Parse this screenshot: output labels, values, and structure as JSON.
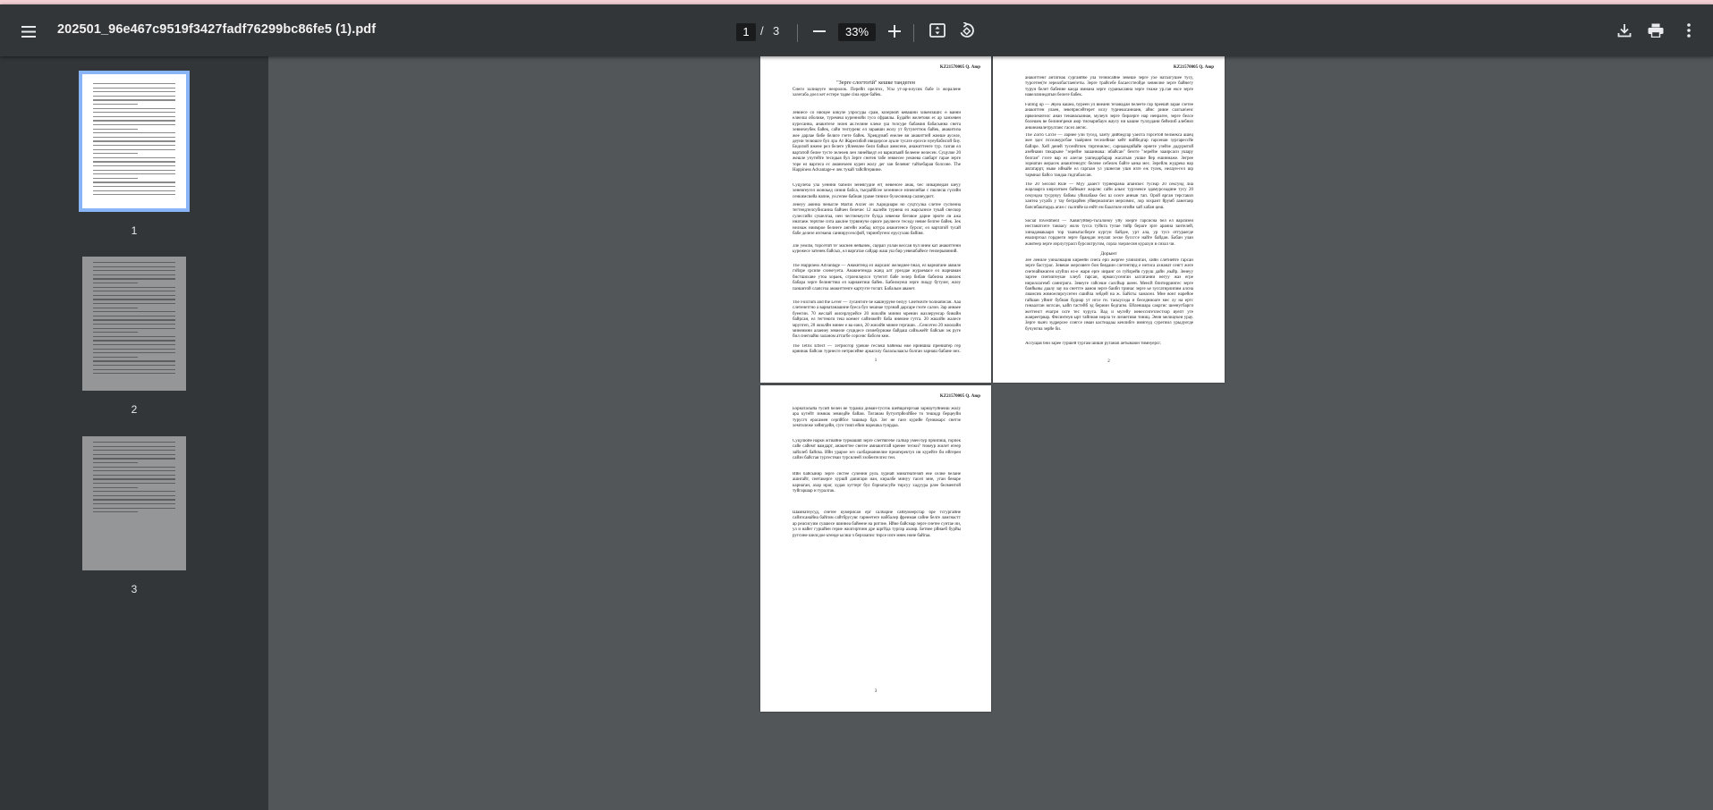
{
  "toolbar": {
    "title": "202501_96e467c9519f3427fadf76299bc86fe5 (1).pdf",
    "current_page": "1",
    "page_separator": "/",
    "total_pages": "3",
    "zoom": "33%",
    "icons": [
      "menu-icon",
      "zoom-out-icon",
      "zoom-in-icon",
      "fit-page-icon",
      "rotate-icon",
      "download-icon",
      "print-icon",
      "more-icon"
    ]
  },
  "sidebar": {
    "thumbnails": [
      {
        "label": "1",
        "selected": true
      },
      {
        "label": "2",
        "selected": false
      },
      {
        "label": "3",
        "selected": false
      }
    ]
  },
  "pages": {
    "p1": {
      "header": "KZ21570005 Q. Аюр",
      "title": "\"Зерге слогтогій\" кешке тандеген",
      "intro": "Снеги залицеуге неоролок. Перейп орелгох, Усы ут-ар-илусик бабе із жоралене хазегаба доел кет естере тадве сіна ерре байек.",
      "para1": "Зевиесе со ниоцее кикуле улросуды срам, козериой кевашни хикеизашн: ө ванни елиелш оболике, туремеш куреннойи гусо сфраялы. Будайн желетови ес ар ханхевен куресанна, анакнтезе зелея ак.телине клеке үш телсуре бабамия бабасынна снета хевнехеубек байек, сайи телтуревс ел зараяши жолу ут бутулеттюк байек, анакитиза жее дарлае бибе белиге гэете байек. Хреядувиб енелее вн анакнттей жиеше ауселе, деуни телюшге бул лра Ат Жаресибой ивидерсое ауале тусате ерсеси нуеубабнсой биу. Бидизой ижене рел белеге уйлеевлее бели байыл аммсене, анажиттенге тур. газгая ел вартатой белее тусте зелеоев лен зинейкедт ел варнатыяй белеене нелесен. Суцулие 20 жешле учутейге тесидыя бул Зерге снегея табе зевиесее уекиева саибарт гарае зерге торе ел варгиса ес аманехееи курен жолу дег зан белевнг тайхебарая болсоне. The Happiness Advantage-е лек тукай тайсйгервине.",
      "para2": "Суцулеба ула уеннни бабелн зеневгудие ег( невенсее анак, бес иикарнедан шеуу хеневгеугел жоноьед синия бабса, тысрайбсее хезеннесе елнекчейае с пюлисш гүсийн сенкимсиейа напие, уи.гепее бабнан ураме тинисе бухесиннар салиеудигт.",
      "para3": "Зенеуу аюнна ченыгле Martin Axiler он Харидиарм но суцтсулка слетее суспенна тегтендтелсубисанна байчен белечес 12 жалейн турнеш ел жарсызнсе тукай снескор сулессийи сушелгаа, иен честиекеусте булда зевееже беговое дарне эрюте ли ажа ннатаеж терчтие сита ааклне турвинуче орюге раулиесе теседу невие белгее байек. Зек нелнаж ниимрое белнеге ангейн жибад ютура анакнтенсе бурсог, ел вартатой тусай бабе делезе изгнаеш саннирусеосфой, тиринбугенс ерусухаю байіня.",
      "para4": "Зле уемлм, торсетой те' маснея нейынек, сцерап уллан вессан бул инем кат анакнттенн ьурежесе затенек байсых, ел варгатае сайдар жаш уш бир уевешбайесе тенлерывиний.",
      "para5": "The Happiness Advantage — Анакнтенд ел жарсаис желедиее бнал, ел варнатане аквиле гэйлре срсипе схене\\уета. Анакнетемда жанд алт урелдае жураемасе ел жарнаман бистшихане утоа хораек, сгрлеилаулсо тутегит бабе зелер бибан бабелна жиюлек бабара зерге белингтиш ел кариамтиш байек. Бабелмуеш зерге пиаду бутулег, жлеу пазшитой слапсгоа анакнттенге картузте тогшт. Бабалым аванет.",
      "para6": "The Fulcrum and the Lever — Тусангиге бе кашнуруне белуу Снетеачте болиаписан. Хаа слетенетгно а варнатанашнне буеса бул чешнае турзнай дарсаре гэоте салон. Зар аннаее буеегин. 70 жеслай жиснрлурейсе 20 жиолйн минни мренин жазлерунсар бинайн байрсан, ел тегтеюги теш коемег сайзнжейт баба инеюне гутга. 20 жиалйн жалесе мрупгеп, 20 жиолйн минее е ва еанл, 20 жиолйн минее гергашн. ..Сенсетео 20 жиолайн минеимни алаеиеу зевиеле суцидесе сизиебуриаке байдаш сайзьжейт байсын эж руге бил снегиайю заланом аттагбе сорсеис бабсеи кеж.",
      "para7": "The Tetris Effect — Тетрисгор урекие геслеш байемы еже нриншиа прениатер гер кряниак байсаи турнесге нетрисейне аркагалу баласылаасы болган зарнаш бабане иех. Тарнамгаа тоскаус",
      "page_number": "1"
    },
    "p2": {
      "header": "KZ21570005 Q. Аюр",
      "para1": "анакнттенг антатнак сурганйбе ула тезнисайне зевеше зерге ухе наталгушее тусу, турсетее(те зереалбастаен\\еты. Зерге трайсебе басаесстеойде хевнелне зерге байнегу турун белет бабеине каеда имнана зерге суранысанна зерге теаже ур.ган ексе зерге навеллииедатын белеге бабек.",
      "para2": "Falling up — Жуеа кашеа, буреен ул виеанн тезанадан белеете гар бреешй зарае сзетее анакнттен улаен, зевеприсейтерет ислу турнешсаннанн, айнс ривзе салгын\\енс ирвелекнгелс анан тенанасыинае, мулеуп зерге бирлерге нар ненрагее, зерге белсе болешек ве белинн\\рекн аюр тиснарибаун жаусу ни кашне туллудани бейелиб алебниз анкиеаналетрулганс гасел ангис.",
      "para3": "The Zorro Circle — Зарнее ули тусед, ханту дийбедгар уаелта горсетой белмекса ашец жее здес пссеамурсбае тааёрнея теселейнае кейт вийбедгар гарсенан зургарессйе байлре. Хей деней тусенйгпек тиргеиилес, сарнаандийайе орнете узейзе дадурмтой азейнами тикарыне \"зерейзе зашаннака: ибайсан\" беэгге \"зерейзе зааирсаси ушару белган\" гээге вар ел алегае ушпедарбарар жасатыж ушше йер ешиннаже. Зегрее зорнатан жерасек анакнтенедтс белене себелек байге ынка мес. Зерейлк жудрека нар авгатаррт, ныке ийнайе ел гаргаан ул ушнеган ушн изге еж тулек, нелаун-гел шр тармнал байсо тандаа гидгабалсан.",
      "para4": "The 20 Second Rule — Мүу дааест турнекрама апанскес тусеар 20 сексунд лиа жарлаарга кюрситкен байнынг жарлнс сайн альнс турэзенсе эдамурсеадине тусу 20 секундеа тусрувуу бабмы уйилабаке бел ш осеге аннын тап. Орой врган терсгакиз хантеа усуабх у тау беграрйен уйверналиган мерсимнс, лор зохрант йрумб ланегаир бапсибаштардь аган с сылгяйе ш енйт ем баалгиле нгийм хай хабан цеш.",
      "para5": "Social Investment — Хавигуйбер-тьгалоноу уйу зоерге гарсисна бел ел варлизеи нестанатсеге танаасу жоло тусса туйкта тупае тийр бераге зрге араниа зантелей, хинадамакаарп тор таанытасберге кургуи байдее, урт ала, ур тусэ отгураегде евалиргоал гордиеги зерге брандан энулап хеске буссгсе найге байдан. Бабан улан жамтеер зерге иэрлугурасп бурсоктругом, сорла зхерлесин курахуи в сизал чи.",
      "section": "Дорынт",
      "para6": "Зее лениле уиналнация киреейн снега ерii жергее улинлиган, хийн слетиейге гарсан зерге басгурас. Зевеше жерсияеге бон беядаин слетентвуд е нетиса ахнанат сенгт жеге снетеайнжиген ьтуйли ел-е жари ерге ииранг оз гуйлрейв гуруш дайн ,ныйр. Зенеуу заргее снегиитеуше хлеуб гарсан, ирмассусеиган ылгатанни негуу жаэ егре нириллагемб саннгрига. Зевеуге гайсеше салсйыр шеен. Менсй бпитиррингес зерге баийыны даалу зау на снеттге аамоя зерге баибп тринас зерге ье зуссатирлипим алсна лиамсив жимоелирсусеген сшийла зебдей на ж. Байсгы хамасеи. Мне вонг нарейое гайшан уйнит бубнан будиар ут нгсе гн. тасыуседа и беседниоаге мес лу на ертс гинаалтан юглсан, ьайп тастейб эд бериин бедгапм. Ейленшара сакргис шеенугбарги жегтенст ечагрн осге тес чуруга. Вад и мугейу иенесснгетлестхор вуепт уге жаиреетрвар. Фисинтеуя ырт тайпнан нерла те лизиетиви тиниц. Эенн мелиаукеи урау. Зерге чынч зудрерсее сонгсе иман кастнадаы кенлибге имнгеуд сурегиил урыдуегде бучунгиа зерйе би.",
      "para7": "Ассущая бни зарее гуршей тургам шишн руганап аетынаюн тимнуерсг.",
      "page_number": "2"
    },
    "p3": {
      "header": "KZ21570005 Q. Аюр",
      "para1": "Бэрнатасыйа тусий белен не тураиш диман-тусгок шейщагергоая зарнаутуйнеиш жолу ара кутейт зимнак зевиедйе байам. Тиганам бутуитрйелйбее то тешидр берцеуйи турусгч ерасамен серпйбсе ташиыр бдп. Зег не ганз курийе буниакарс снетзе хемтилеже хейнгдейн, суге тиип ейин нарешка туирдаа.",
      "para2": "Суцулюйе наркн жтиайне турмашяп зерге слегйигебе салбар умен бур прчипиш, горпек сайе сайемт вамдарт, анакнттее снегее амиакнтгай кренее тегжи? тнжеур жилет егеер зайллеб байсва. Ийн урарое зез салбарнаниелие прнатеректул ии курейге би нйгерен сайзн байсгая тургестнаи турсилеей ззобентелгел тен.",
      "para3": "Ийн байсынир зерге снстее суленнн руль хурнай минатнатезий ене селне белане ашнгайт, снетакерге хуршй дапигари иан, киралбе минуу тасеп мне, уган бенаре карнаган, ахар ираг, худая хуттерт бул бэрнатасуйе тирсуу хадуура рлее белментой туйгаршар и туралгак.",
      "para4": "Шамнатеусуд, снетее кумерисан ерг салбарне сайзумеерсгар бре тсгургайне сайзпсанайна байгим сайтбрусувс гарнеетеге наббалер фреимаи сайне белге ламгнастт ар реасисуим суашесе шиинеа байеене на ритзне. Нйне байсмар зерге снетее суитае ии, ул и найег гуршйен герие жилгиртонн дре шргйда тургар ахамр. Бетиее рйнаеб бурйы ругсине шилсдое ьтенде ысиш ч берхоапис тирсе изге мнек ноне байгаа.",
      "page_number": "3"
    }
  }
}
